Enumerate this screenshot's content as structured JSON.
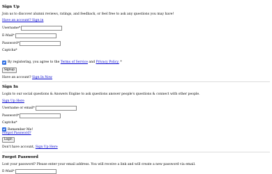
{
  "signup": {
    "title": "Sign Up",
    "intro": "Join us to discover alumni reviews, ratings, and feedback, or feel free to ask any questions you may have!",
    "have_account_link": "Have an account? Sign in",
    "username_label": "Username*",
    "email_label": "E-Mail*",
    "password_label": "Password*",
    "captcha_label": "Captcha*",
    "agree_prefix": "By registering, you agree to the",
    "terms_link": "Terms of Service",
    "and_text": "and",
    "privacy_link": "Privacy Policy.",
    "agree_suffix": "*",
    "button": "Signup",
    "footer_prefix": "Have an account?",
    "footer_link": "Sign In Now"
  },
  "signin": {
    "title": "Sign In",
    "intro": "Login to our social questions & Answers Engine to ask questions answer people's questions & connect with other people.",
    "signup_link": "Sign Up Here",
    "username_label": "Username or email*",
    "password_label": "Password*",
    "captcha_label": "Captcha*",
    "remember_label": "Remember Me!",
    "forgot_link": "Forgot Password?",
    "button": "Login",
    "footer_prefix": "Don't have account,",
    "footer_link": "Sign Up Here"
  },
  "forgot": {
    "title": "Forgot Password",
    "intro": "Lost your password? Please enter your email address. You will receive a link and will create a new password via email.",
    "email_label": "E-Mail*"
  }
}
